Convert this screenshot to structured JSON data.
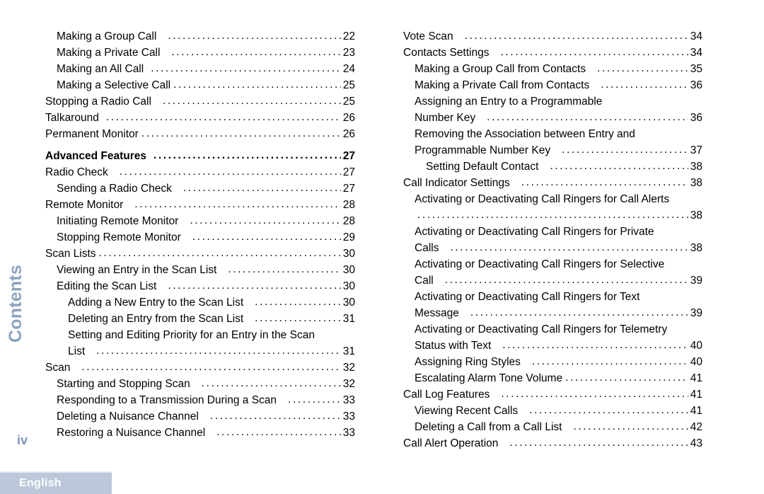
{
  "document": {
    "section_label": "Contents",
    "folio": "iv",
    "language_tab": "English"
  },
  "colors": {
    "background": "#ffffff",
    "text": "#000000",
    "section_label": "#8aa2bd",
    "folio": "#7e97b6",
    "tab_background": "#bcc8da",
    "tab_text": "#ffffff",
    "tab_top_border": "#e2eaf6"
  },
  "columns": {
    "left": [
      {
        "level": 2,
        "heading": false,
        "title": "Making a Group Call",
        "gap": "md",
        "page": "22"
      },
      {
        "level": 2,
        "heading": false,
        "title": "Making a Private Call",
        "gap": "md",
        "page": "23"
      },
      {
        "level": 2,
        "heading": false,
        "title": "Making an All Call",
        "gap": "sm",
        "page": "24"
      },
      {
        "level": 2,
        "heading": false,
        "title": "Making a Selective Call",
        "gap": "none",
        "page": "25"
      },
      {
        "level": 1,
        "heading": false,
        "title": "Stopping a Radio Call",
        "gap": "md",
        "page": "25"
      },
      {
        "level": 1,
        "heading": false,
        "title": "Talkaround",
        "gap": "sm",
        "page": "26"
      },
      {
        "level": 1,
        "heading": false,
        "title": "Permanent Monitor",
        "gap": "none",
        "page": "26"
      },
      {
        "level": 0,
        "heading": true,
        "title": "Advanced Features",
        "gap": "sm",
        "page": "27"
      },
      {
        "level": 1,
        "heading": false,
        "title": "Radio Check",
        "gap": "md",
        "page": "27"
      },
      {
        "level": 2,
        "heading": false,
        "title": "Sending a Radio Check",
        "gap": "md",
        "page": "27"
      },
      {
        "level": 1,
        "heading": false,
        "title": "Remote Monitor",
        "gap": "md",
        "page": "28"
      },
      {
        "level": 2,
        "heading": false,
        "title": "Initiating Remote Monitor",
        "gap": "md",
        "page": "28"
      },
      {
        "level": 2,
        "heading": false,
        "title": "Stopping Remote Monitor",
        "gap": "md",
        "page": "29"
      },
      {
        "level": 1,
        "heading": false,
        "title": "Scan Lists",
        "gap": "none",
        "page": "30"
      },
      {
        "level": 2,
        "heading": false,
        "title": "Viewing an Entry in the Scan List",
        "gap": "md",
        "page": "30"
      },
      {
        "level": 2,
        "heading": false,
        "title": "Editing the Scan List",
        "gap": "md",
        "page": "30"
      },
      {
        "level": 3,
        "heading": false,
        "title": "Adding a New Entry to the Scan List",
        "gap": "md",
        "page": "30"
      },
      {
        "level": 3,
        "heading": false,
        "title": "Deleting an Entry from the Scan List",
        "gap": "md",
        "page": "31"
      },
      {
        "level": 3,
        "heading": false,
        "wrap": [
          "Setting and Editing Priority for an Entry in the Scan"
        ],
        "title": "List",
        "gap": "md",
        "page": "31"
      },
      {
        "level": 1,
        "heading": false,
        "title": "Scan",
        "gap": "md",
        "page": "32"
      },
      {
        "level": 2,
        "heading": false,
        "title": "Starting and Stopping Scan",
        "gap": "md",
        "page": "32"
      },
      {
        "level": 2,
        "heading": false,
        "title": "Responding to a Transmission During a Scan",
        "gap": "md",
        "page": "33"
      },
      {
        "level": 2,
        "heading": false,
        "title": "Deleting a Nuisance Channel",
        "gap": "md",
        "page": "33"
      },
      {
        "level": 2,
        "heading": false,
        "title": "Restoring a Nuisance Channel",
        "gap": "md",
        "page": "33"
      }
    ],
    "right": [
      {
        "level": 1,
        "heading": false,
        "title": "Vote Scan",
        "gap": "md",
        "page": "34"
      },
      {
        "level": 1,
        "heading": false,
        "title": "Contacts Settings",
        "gap": "md",
        "page": "34"
      },
      {
        "level": 2,
        "heading": false,
        "title": "Making a Group Call from Contacts",
        "gap": "md",
        "page": "35"
      },
      {
        "level": 2,
        "heading": false,
        "title": "Making a Private Call from Contacts",
        "gap": "md",
        "page": "36"
      },
      {
        "level": 2,
        "heading": false,
        "wrap": [
          "Assigning an Entry to a Programmable"
        ],
        "title": "Number Key",
        "gap": "md",
        "page": "36"
      },
      {
        "level": 2,
        "heading": false,
        "wrap": [
          "Removing the Association between Entry and"
        ],
        "title": "Programmable Number Key",
        "gap": "md",
        "page": "37"
      },
      {
        "level": 3,
        "heading": false,
        "title": "Setting Default Contact",
        "gap": "md",
        "page": "38"
      },
      {
        "level": 1,
        "heading": false,
        "title": "Call Indicator Settings",
        "gap": "md",
        "page": "38"
      },
      {
        "level": 2,
        "heading": false,
        "wrap": [
          "Activating or Deactivating Call Ringers for Call Alerts"
        ],
        "title": "",
        "gap": "none",
        "page": "38"
      },
      {
        "level": 2,
        "heading": false,
        "wrap": [
          "Activating or Deactivating Call Ringers for Private"
        ],
        "title": "Calls",
        "gap": "md",
        "page": "38"
      },
      {
        "level": 2,
        "heading": false,
        "wrap": [
          "Activating or Deactivating Call Ringers for Selective"
        ],
        "title": "Call",
        "gap": "md",
        "page": "39"
      },
      {
        "level": 2,
        "heading": false,
        "wrap": [
          "Activating or Deactivating Call Ringers for Text"
        ],
        "title": "Message",
        "gap": "md",
        "page": "39"
      },
      {
        "level": 2,
        "heading": false,
        "wrap": [
          "Activating or Deactivating Call Ringers for Telemetry"
        ],
        "title": "Status with Text",
        "gap": "md",
        "page": "40"
      },
      {
        "level": 2,
        "heading": false,
        "title": "Assigning Ring Styles",
        "gap": "md",
        "page": "40"
      },
      {
        "level": 2,
        "heading": false,
        "title": "Escalating Alarm Tone Volume",
        "gap": "none",
        "page": "41"
      },
      {
        "level": 1,
        "heading": false,
        "title": "Call Log Features",
        "gap": "md",
        "page": "41"
      },
      {
        "level": 2,
        "heading": false,
        "title": "Viewing Recent Calls",
        "gap": "md",
        "page": "41"
      },
      {
        "level": 2,
        "heading": false,
        "title": "Deleting a Call from a Call List",
        "gap": "md",
        "page": "42"
      },
      {
        "level": 1,
        "heading": false,
        "title": "Call Alert Operation",
        "gap": "md",
        "page": "43"
      }
    ]
  }
}
